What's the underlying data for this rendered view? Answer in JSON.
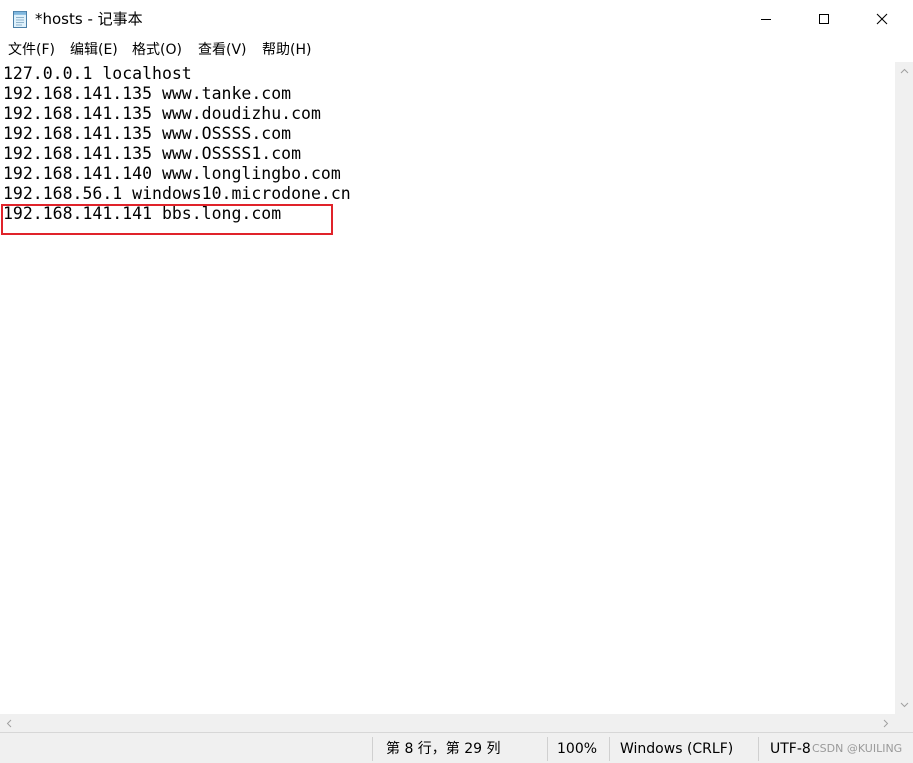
{
  "window": {
    "title": "*hosts - 记事本",
    "icon": "notepad-icon",
    "controls": [
      "minimize-icon",
      "maximize-icon",
      "close-icon"
    ]
  },
  "menu": {
    "file": "文件(F)",
    "edit": "编辑(E)",
    "format": "格式(O)",
    "view": "查看(V)",
    "help": "帮助(H)"
  },
  "editor": {
    "lines": [
      "127.0.0.1 localhost",
      "192.168.141.135 www.tanke.com",
      "192.168.141.135 www.doudizhu.com",
      "192.168.141.135 www.OSSSS.com",
      "192.168.141.135 www.OSSSS1.com",
      "192.168.141.140 www.longlingbo.com",
      "192.168.56.1 windows10.microdone.cn",
      "192.168.141.141 bbs.long.com"
    ],
    "highlighted_line": 7,
    "highlight_color": "#e0232a"
  },
  "status": {
    "position": "第 8 行，第 29 列",
    "zoom": "100%",
    "line_ending": "Windows (CRLF)",
    "encoding": "UTF-8"
  },
  "watermark": "CSDN @KUILING"
}
